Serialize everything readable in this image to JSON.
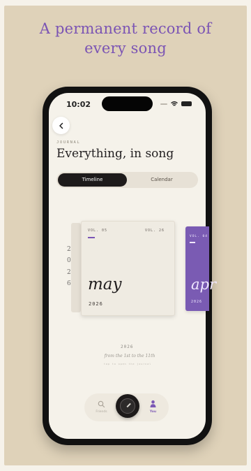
{
  "promo": {
    "headline_line1": "A permanent record of",
    "headline_line2": "every song"
  },
  "status": {
    "time": "10:02"
  },
  "header": {
    "kicker": "JOURNAL",
    "title": "Everything, in song"
  },
  "segmented": {
    "active": "Timeline",
    "inactive": "Calendar"
  },
  "timeline": {
    "year_vertical": [
      "2",
      "0",
      "2",
      "6"
    ],
    "main_card": {
      "vol_left": "VOL. 05",
      "vol_right": "VOL. 26",
      "month": "may",
      "year": "2026"
    },
    "next_card": {
      "meta": "VOL. 04",
      "month": "apr",
      "year": "2026"
    },
    "caption_year": "2026",
    "caption_range": "from the 1st to the 11th",
    "caption_small": "tap to open the journal"
  },
  "tabbar": {
    "friends_label": "Friends",
    "you_label": "You"
  },
  "colors": {
    "accent": "#7b54b4",
    "background": "#dfd2b9",
    "screen": "#f5f2ea"
  }
}
